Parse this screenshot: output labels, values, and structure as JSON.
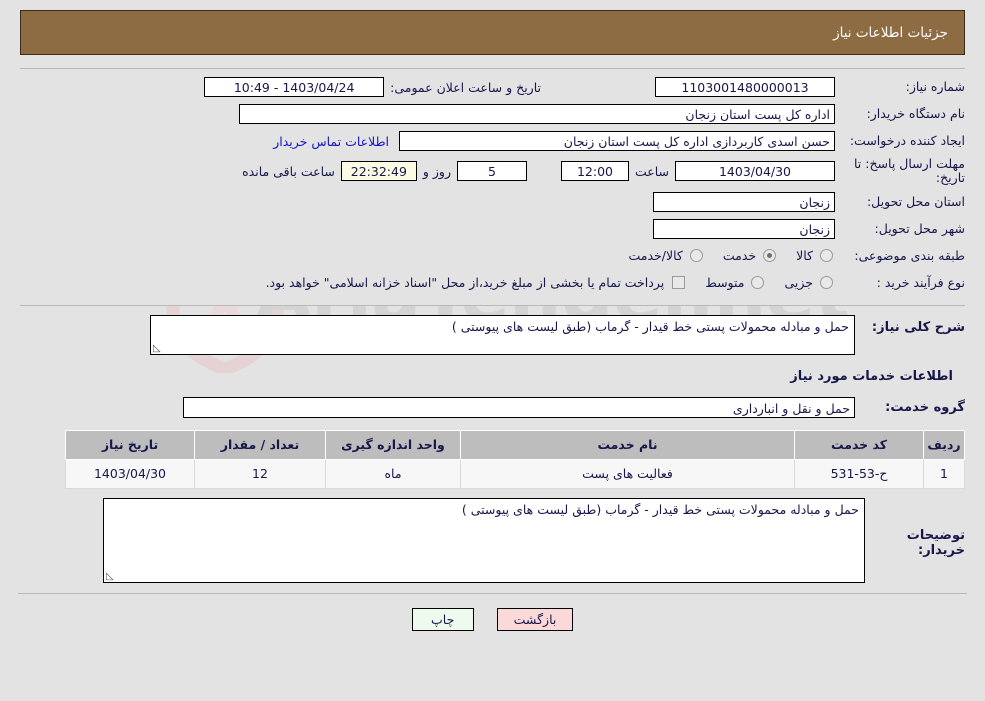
{
  "header": {
    "title": "جزئیات اطلاعات نیاز"
  },
  "form": {
    "need_number_label": "شماره نیاز:",
    "need_number_value": "1103001480000013",
    "public_announce_label": "تاریخ و ساعت اعلان عمومی:",
    "public_announce_value": "1403/04/24 - 10:49",
    "buyer_org_label": "نام دستگاه خریدار:",
    "buyer_org_value": "اداره کل پست استان زنجان",
    "creator_label": "ایجاد کننده درخواست:",
    "creator_value": "حسن  اسدی کاربردازی اداره کل پست استان زنجان",
    "contact_link": "اطلاعات تماس خریدار",
    "deadline_label": "مهلت ارسال پاسخ: تا تاریخ:",
    "deadline_date": "1403/04/30",
    "hour_label": "ساعت",
    "deadline_time": "12:00",
    "days_remaining": "5",
    "days_label": "روز و",
    "countdown": "22:32:49",
    "remaining_label": "ساعت باقی مانده",
    "delivery_province_label": "استان محل تحویل:",
    "delivery_province_value": "زنجان",
    "delivery_city_label": "شهر محل تحویل:",
    "delivery_city_value": "زنجان",
    "category_label": "طبقه بندی موضوعی:",
    "category_options": [
      {
        "label": "کالا",
        "selected": false
      },
      {
        "label": "خدمت",
        "selected": true
      },
      {
        "label": "کالا/خدمت",
        "selected": false
      }
    ],
    "process_label": "نوع فرآیند خرید :",
    "process_options": [
      {
        "label": "جزیی",
        "selected": false
      },
      {
        "label": "متوسط",
        "selected": false
      }
    ],
    "treasury_checkbox_checked": false,
    "treasury_note": "پرداخت تمام یا بخشی از مبلغ خرید،از محل \"اسناد خزانه اسلامی\" خواهد بود."
  },
  "summary": {
    "need_desc_label": "شرح کلی نیاز:",
    "need_desc_value": "حمل و مبادله محمولات پستی خط قیدار - گرماب (طبق لیست های پیوستی )",
    "services_section_title": "اطلاعات خدمات مورد نیاز",
    "service_group_label": "گروه خدمت:",
    "service_group_value": "حمل و نقل و انبارداری"
  },
  "table": {
    "columns": [
      "ردیف",
      "کد خدمت",
      "نام خدمت",
      "واحد اندازه گیری",
      "تعداد / مقدار",
      "تاریخ نیاز"
    ],
    "rows": [
      {
        "index": "1",
        "code": "ح-53-531",
        "name": "فعالیت های پست",
        "unit": "ماه",
        "quantity": "12",
        "date": "1403/04/30"
      }
    ]
  },
  "buyer_notes": {
    "label": "توضیحات خریدار:",
    "value": "حمل و مبادله محمولات پستی خط قیدار - گرماب (طبق لیست های پیوستی )"
  },
  "footer": {
    "print_label": "چاپ",
    "back_label": "بازگشت"
  },
  "watermark": {
    "text": "AriaTender.net"
  },
  "colors": {
    "header_bar": "#8d6b43",
    "link": "#1414c8",
    "timer_bg": "#fbfbe4",
    "print_btn": "#eefaee",
    "back_btn": "#fcd9d9"
  }
}
